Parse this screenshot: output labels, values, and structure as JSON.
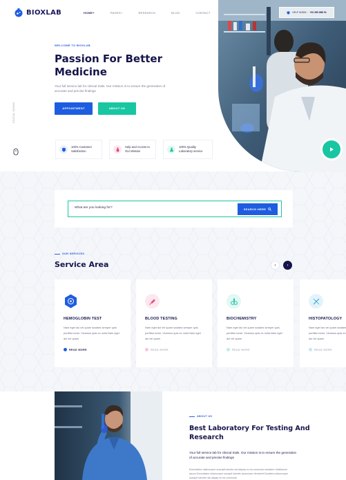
{
  "brand": {
    "name": "BIOXLAB"
  },
  "nav": {
    "items": [
      {
        "label": "HOME+",
        "active": true
      },
      {
        "label": "PAGES+",
        "active": false
      },
      {
        "label": "RESEARCH",
        "active": false
      },
      {
        "label": "BLOG",
        "active": false
      },
      {
        "label": "CONTACT",
        "active": false
      }
    ]
  },
  "help": {
    "label": "HELP ANSW :",
    "phone": "+91 990 888 91"
  },
  "hero": {
    "eyebrow": "WELCOME TO BIOXLAB",
    "title": "Passion For Better Medicine",
    "description": "Your full service lab for clinical trials. Our mission is to ensure the generation of accurate and precise findings",
    "appointment_label": "APPOINTMENT",
    "about_label": "ABOUT US",
    "social_label": "SOCIAL DOWN"
  },
  "features": [
    {
      "text": "100% Customer Satisfaction",
      "icon": "shield-icon",
      "color": "#1f5de0"
    },
    {
      "text": "Help and Access to Our Mission",
      "icon": "lab-icon",
      "color": "#e8457a"
    },
    {
      "text": "100% Quality Laboratory service",
      "icon": "flask-icon",
      "color": "#19c6a2"
    }
  ],
  "search": {
    "placeholder": "What are you looking for?",
    "button_label": "SEARCH HERE"
  },
  "services": {
    "eyebrow": "OUR SERVICES",
    "title": "Service Area",
    "cards": [
      {
        "title": "HEMOGLOBIN TEST",
        "desc": "Nam eget dui vel quam sodales semper quis porttitor tortor. Vivamus quis ex nulla Nam eget dui vel quam",
        "more": "READ MORE",
        "icon": "blood-cell-icon",
        "accent": "#1f5de0"
      },
      {
        "title": "BLOOD TESTING",
        "desc": "Nam eget dui vel quam sodales semper quis porttitor tortor. Vivamus quis ex nulla Nam eget dui vel quam",
        "more": "READ MORE",
        "icon": "syringe-icon",
        "accent": "#e8457a"
      },
      {
        "title": "BIOCHEMISTRY",
        "desc": "Nam eget dui vel quam sodales semper quis porttitor tortor. Vivamus quis ex nulla Nam eget dui vel quam",
        "more": "READ MORE",
        "icon": "microscope-icon",
        "accent": "#19c6a2"
      },
      {
        "title": "HISTOPATOLOGY",
        "desc": "Nam eget dui vel quam sodales semper quis porttitor tortor. Vivamus quis ex nulla Nam eget dui vel quam",
        "more": "READ MORE",
        "icon": "dna-icon",
        "accent": "#3aa7d8"
      }
    ]
  },
  "about": {
    "eyebrow": "ABOUT US",
    "title": "Best Laboratory For Testing And Research",
    "lead": "Your full service lab for clinical trials. Our mission is to ensure the generation of accurate and precise findings",
    "body": "Exercitation ullamcorper suscipit lobortis nisl aliquip ex ea commodo duriatem Vestibulum ipsum Exercitation ullamcorper suscipit lobortis accumsan Hendrerit Duriatem ullamcorper suscipit lobortis nisl aliquip ex ea commodo"
  },
  "colors": {
    "primary": "#1f5de0",
    "teal": "#19c6a2",
    "navy": "#15154a",
    "pink": "#e8457a"
  }
}
